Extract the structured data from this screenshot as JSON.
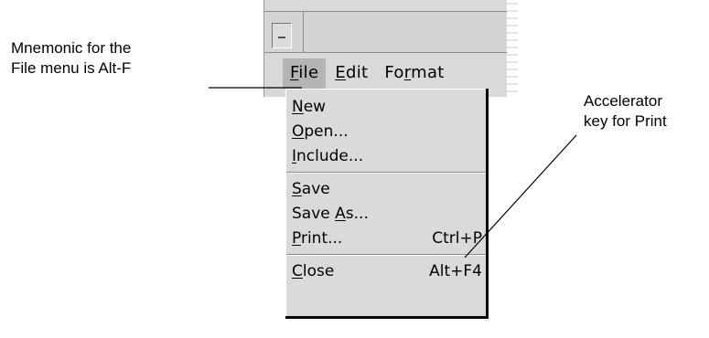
{
  "callouts": {
    "mnemonic_line1": "Mnemonic for the",
    "mnemonic_line2": "File menu is Alt-F",
    "accelerator_line1": "Accelerator",
    "accelerator_line2": "key for Print"
  },
  "menubar": {
    "file": {
      "mnemonic": "F",
      "rest": "ile"
    },
    "edit": {
      "mnemonic": "E",
      "rest": "dit"
    },
    "format": {
      "before": "Fo",
      "mnemonic": "r",
      "after": "mat"
    }
  },
  "file_menu": {
    "new": {
      "mnemonic": "N",
      "rest": "ew"
    },
    "open": {
      "mnemonic": "O",
      "rest": "pen..."
    },
    "include": {
      "mnemonic": "I",
      "rest": "nclude..."
    },
    "save": {
      "mnemonic": "S",
      "rest": "ave"
    },
    "save_as": {
      "before": "Save ",
      "mnemonic": "A",
      "rest": "s..."
    },
    "print": {
      "mnemonic": "P",
      "rest": "rint...",
      "accelerator": "Ctrl+P"
    },
    "close": {
      "mnemonic": "C",
      "rest": "lose",
      "accelerator": "Alt+F4"
    }
  },
  "colors": {
    "menu_bg": "#dadada",
    "active_menubar_bg": "#b4b4b4",
    "window_bg": "#d9d9d9"
  },
  "icons": {
    "window_menu_button": "dash-icon"
  }
}
